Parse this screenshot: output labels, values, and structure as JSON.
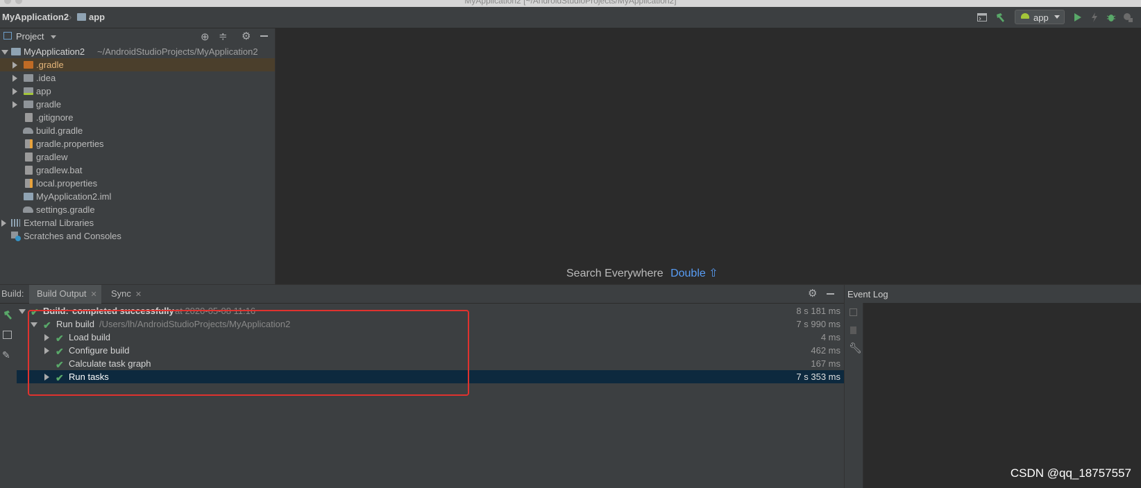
{
  "window": {
    "title": "MyApplication2 [~/AndroidStudioProjects/MyApplication2]"
  },
  "navbar": {
    "breadcrumbs": [
      "MyApplication2",
      "app"
    ],
    "run_config": "app",
    "icons": [
      "terminal-icon",
      "build-hammer-icon",
      "android-icon",
      "run-icon",
      "apply-changes-icon",
      "debug-icon",
      "profile-icon"
    ]
  },
  "project_panel": {
    "title": "Project",
    "tree": [
      {
        "label": "MyApplication2",
        "path": "~/AndroidStudioProjects/MyApplication2",
        "icon": "module-folder-icon",
        "expanded": true
      },
      {
        "label": ".gradle",
        "icon": "folder-icon",
        "color": "#c06b25",
        "selected": true
      },
      {
        "label": ".idea",
        "icon": "folder-icon"
      },
      {
        "label": "app",
        "icon": "android-module-folder-icon"
      },
      {
        "label": "gradle",
        "icon": "folder-icon"
      },
      {
        "label": ".gitignore",
        "icon": "text-file-icon"
      },
      {
        "label": "build.gradle",
        "icon": "gradle-icon"
      },
      {
        "label": "gradle.properties",
        "icon": "properties-file-icon"
      },
      {
        "label": "gradlew",
        "icon": "text-file-icon"
      },
      {
        "label": "gradlew.bat",
        "icon": "text-file-icon"
      },
      {
        "label": "local.properties",
        "icon": "properties-file-icon"
      },
      {
        "label": "MyApplication2.iml",
        "icon": "module-file-icon"
      },
      {
        "label": "settings.gradle",
        "icon": "gradle-icon"
      },
      {
        "label": "External Libraries",
        "icon": "libraries-icon"
      },
      {
        "label": "Scratches and Consoles",
        "icon": "scratches-icon"
      }
    ]
  },
  "editor": {
    "hint_text": "Search Everywhere",
    "hint_shortcut": "Double ⇧"
  },
  "build": {
    "label": "Build:",
    "tabs": [
      "Build Output",
      "Sync"
    ],
    "rows": [
      {
        "label": "Build:",
        "detail": "completed successfully",
        "time": "at 2020-05-08 11:16",
        "duration": "8 s 181 ms"
      },
      {
        "label": "Run build",
        "detail": "/Users/lh/AndroidStudioProjects/MyApplication2",
        "duration": "7 s 990 ms"
      },
      {
        "label": "Load build",
        "duration": "4 ms"
      },
      {
        "label": "Configure build",
        "duration": "462 ms"
      },
      {
        "label": "Calculate task graph",
        "duration": "167 ms"
      },
      {
        "label": "Run tasks",
        "duration": "7 s 353 ms",
        "selected": true
      }
    ]
  },
  "event_log": {
    "title": "Event Log"
  },
  "watermark": "CSDN @qq_18757557",
  "colors": {
    "accent_link": "#589df6",
    "check_green": "#59a869",
    "annotation_red": "#e0322e",
    "selection": "#0d293e"
  }
}
